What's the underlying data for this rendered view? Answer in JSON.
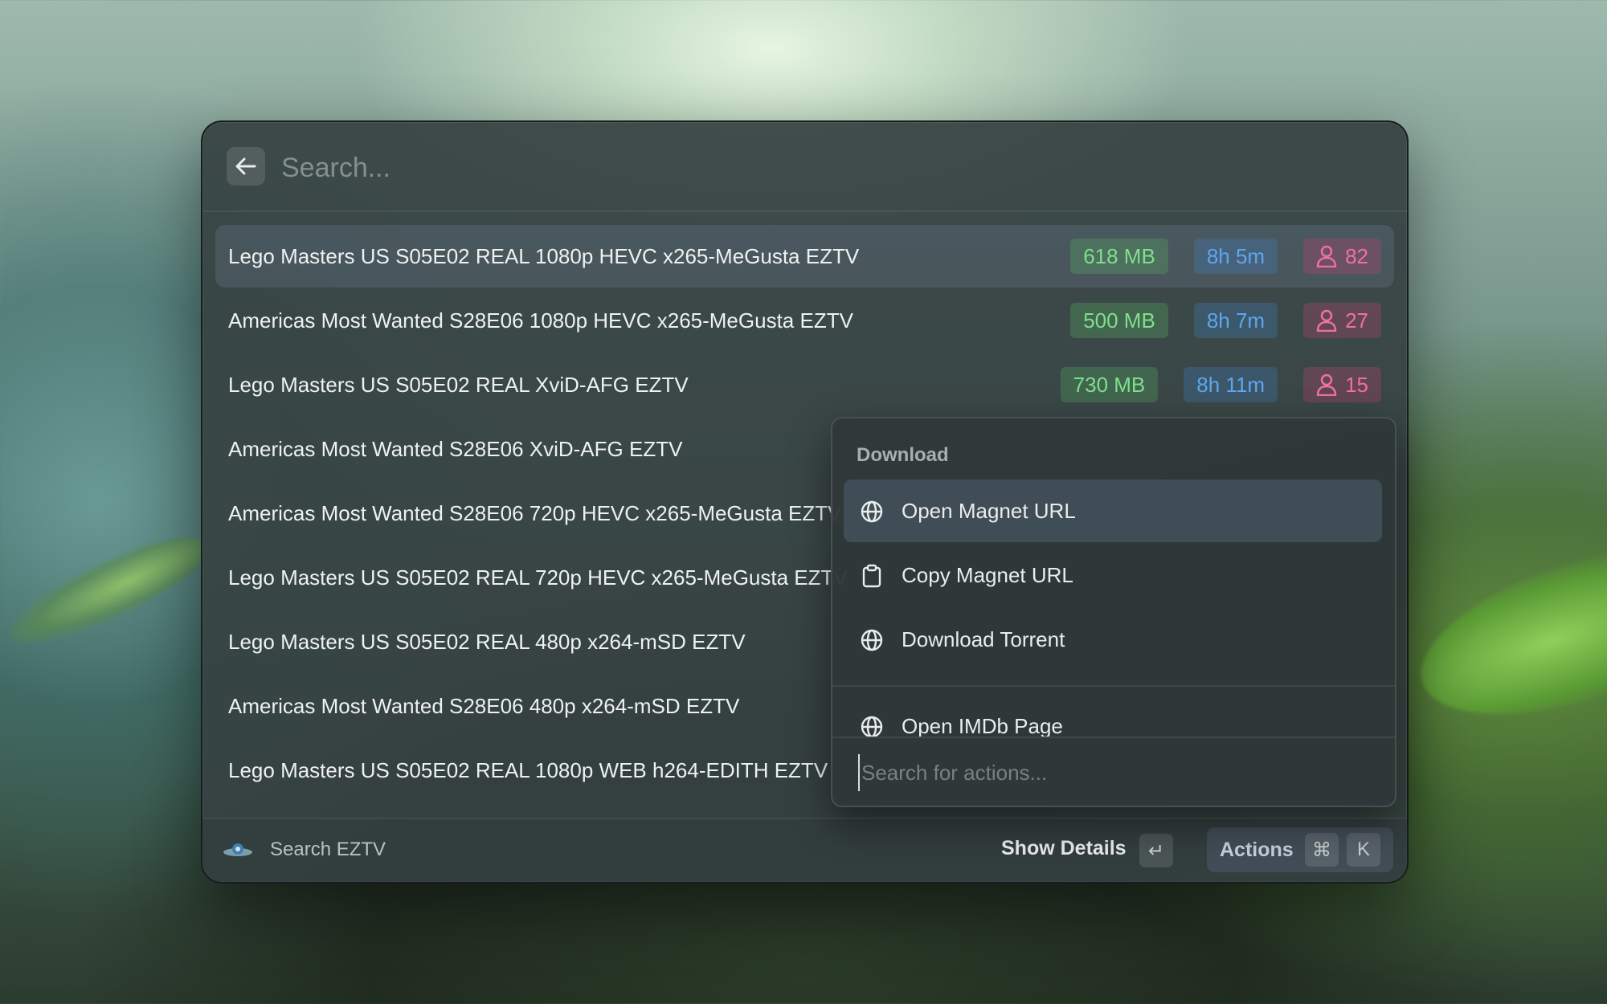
{
  "search": {
    "placeholder": "Search..."
  },
  "results": [
    {
      "title": "Lego Masters US S05E02 REAL 1080p HEVC x265-MeGusta EZTV",
      "size": "618 MB",
      "age": "8h 5m",
      "seeds": "82"
    },
    {
      "title": "Americas Most Wanted S28E06 1080p HEVC x265-MeGusta EZTV",
      "size": "500 MB",
      "age": "8h 7m",
      "seeds": "27"
    },
    {
      "title": "Lego Masters US S05E02 REAL XviD-AFG EZTV",
      "size": "730 MB",
      "age": "8h 11m",
      "seeds": "15"
    },
    {
      "title": "Americas Most Wanted S28E06 XviD-AFG EZTV"
    },
    {
      "title": "Americas Most Wanted S28E06 720p HEVC x265-MeGusta EZTV"
    },
    {
      "title": "Lego Masters US S05E02 REAL 720p HEVC x265-MeGusta EZTV"
    },
    {
      "title": "Lego Masters US S05E02 REAL 480p x264-mSD EZTV"
    },
    {
      "title": "Americas Most Wanted S28E06 480p x264-mSD EZTV"
    },
    {
      "title": "Lego Masters US S05E02 REAL 1080p WEB h264-EDITH EZTV"
    }
  ],
  "footer": {
    "extension_name": "Search EZTV",
    "primary_action": "Show Details",
    "enter_key": "↵",
    "actions_label": "Actions",
    "cmd_key": "⌘",
    "k_key": "K"
  },
  "action_panel": {
    "section_title": "Download",
    "items": [
      {
        "label": "Open Magnet URL",
        "icon": "globe-icon"
      },
      {
        "label": "Copy Magnet URL",
        "icon": "clipboard-icon"
      },
      {
        "label": "Download Torrent",
        "icon": "globe-icon"
      },
      {
        "label": "Open IMDb Page",
        "icon": "globe-icon"
      }
    ],
    "search_placeholder": "Search for actions..."
  },
  "colors": {
    "size_tag": "#7fe08c",
    "time_tag": "#5fa6ee",
    "seed_tag": "#f0709e"
  }
}
